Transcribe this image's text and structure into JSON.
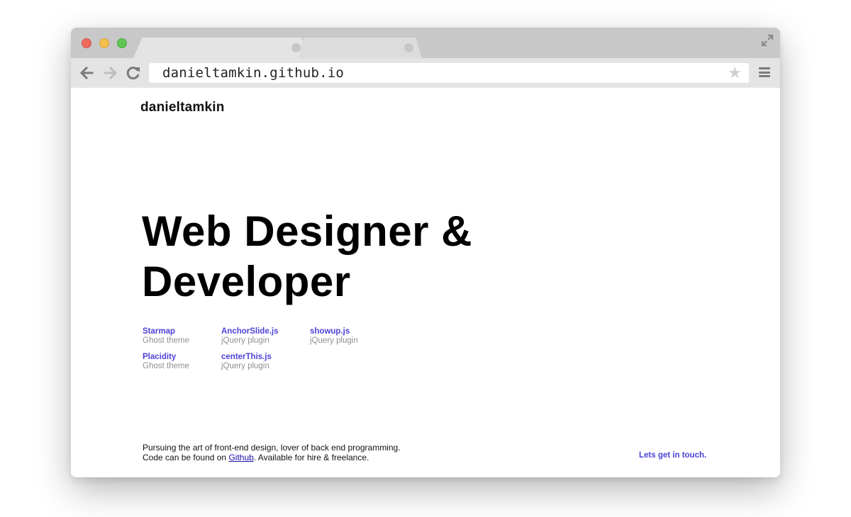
{
  "browser": {
    "url": "danieltamkin.github.io",
    "icons": {
      "back": "arrow-left-icon",
      "forward": "arrow-right-icon",
      "reload": "reload-icon",
      "bookmark": "star-icon",
      "menu": "hamburger-menu-icon",
      "fullscreen": "expand-icon"
    },
    "colors": {
      "close": "#ec6a5e",
      "minimize": "#f4bf4f",
      "zoom": "#61c554"
    }
  },
  "site": {
    "name": "danieltamkin",
    "headline_line1": "Web Designer &",
    "headline_line2": "Developer",
    "projects": [
      {
        "title": "Starmap",
        "subtitle": "Ghost theme"
      },
      {
        "title": "AnchorSlide.js",
        "subtitle": "jQuery plugin"
      },
      {
        "title": "showup.js",
        "subtitle": "jQuery plugin"
      },
      {
        "title": "Placidity",
        "subtitle": "Ghost theme"
      },
      {
        "title": "centerThis.js",
        "subtitle": "jQuery plugin"
      }
    ],
    "footer": {
      "line1": "Pursuing the art of front-end design, lover of back end programming.",
      "line2_before": "Code can be found on ",
      "line2_link": "Github",
      "line2_after": ". Available for hire & freelance."
    },
    "cta": "Lets get in touch.",
    "colors": {
      "accent": "#4b42d6",
      "muted": "#909090",
      "link": "#1a0dab"
    }
  }
}
